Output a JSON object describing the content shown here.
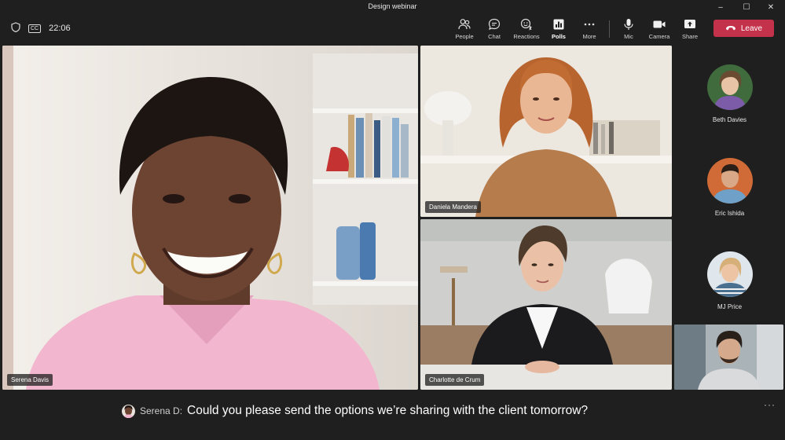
{
  "window": {
    "title": "Design webinar",
    "controls": {
      "minimize": "–",
      "maximize": "☐",
      "close": "✕"
    }
  },
  "toolbar": {
    "timer": "22:06",
    "cc_label": "CC",
    "buttons": [
      {
        "id": "people",
        "label": "People",
        "icon": "people-icon"
      },
      {
        "id": "chat",
        "label": "Chat",
        "icon": "chat-icon"
      },
      {
        "id": "reactions",
        "label": "Reactions",
        "icon": "reactions-icon"
      },
      {
        "id": "polls",
        "label": "Polls",
        "icon": "polls-icon",
        "active": true
      },
      {
        "id": "more",
        "label": "More",
        "icon": "more-icon"
      },
      {
        "id": "mic",
        "label": "Mic",
        "icon": "mic-icon"
      },
      {
        "id": "camera",
        "label": "Camera",
        "icon": "camera-icon"
      },
      {
        "id": "share",
        "label": "Share",
        "icon": "share-icon"
      }
    ],
    "leave_label": "Leave",
    "leave_color": "#c4314b"
  },
  "participants": {
    "main": {
      "name": "Serena Davis"
    },
    "top_right": {
      "name": "Daniela Mandera"
    },
    "bottom_right": {
      "name": "Charlotte de Crum"
    }
  },
  "roster": [
    {
      "name": "Beth Davies"
    },
    {
      "name": "Eric Ishida"
    },
    {
      "name": "MJ Price"
    }
  ],
  "captions": {
    "speaker": "Serena D:",
    "text": "Could you please send the options we’re sharing with the client tomorrow?",
    "more": "···"
  }
}
